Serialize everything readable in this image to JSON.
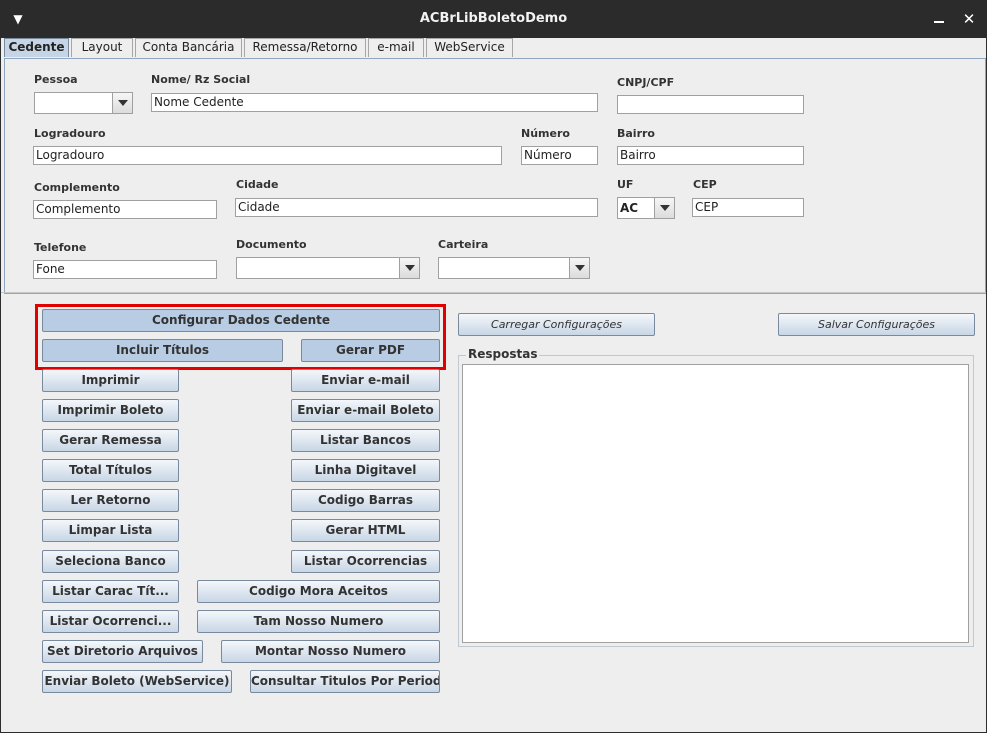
{
  "window": {
    "title": "ACBrLibBoletoDemo"
  },
  "tabs": [
    {
      "label": "Cedente"
    },
    {
      "label": "Layout"
    },
    {
      "label": "Conta Bancária"
    },
    {
      "label": "Remessa/Retorno"
    },
    {
      "label": "e-mail"
    },
    {
      "label": "WebService"
    }
  ],
  "form": {
    "pessoa": {
      "label": "Pessoa",
      "value": ""
    },
    "nome": {
      "label": "Nome/ Rz Social",
      "value": "Nome Cedente"
    },
    "cnpj": {
      "label": "CNPJ/CPF",
      "value": ""
    },
    "logradouro": {
      "label": "Logradouro",
      "value": "Logradouro"
    },
    "numero": {
      "label": "Número",
      "value": "Número"
    },
    "bairro": {
      "label": "Bairro",
      "value": "Bairro"
    },
    "complemento": {
      "label": "Complemento",
      "value": "Complemento"
    },
    "cidade": {
      "label": "Cidade",
      "value": "Cidade"
    },
    "uf": {
      "label": "UF",
      "value": "AC"
    },
    "cep": {
      "label": "CEP",
      "value": "CEP"
    },
    "telefone": {
      "label": "Telefone",
      "value": "Fone"
    },
    "documento": {
      "label": "Documento",
      "value": ""
    },
    "carteira": {
      "label": "Carteira",
      "value": ""
    }
  },
  "buttons": {
    "configurar": "Configurar Dados Cedente",
    "incluir": "Incluir Títulos",
    "gerar_pdf": "Gerar PDF",
    "imprimir": "Imprimir",
    "enviar_email": "Enviar e-mail",
    "imprimir_boleto": "Imprimir Boleto",
    "enviar_email_boleto": "Enviar e-mail Boleto",
    "gerar_remessa": "Gerar Remessa",
    "listar_bancos": "Listar Bancos",
    "total_titulos": "Total Títulos",
    "linha_digitavel": "Linha Digitavel",
    "ler_retorno": "Ler Retorno",
    "codigo_barras": "Codigo Barras",
    "limpar_lista": "Limpar Lista",
    "gerar_html": "Gerar HTML",
    "seleciona_banco": "Seleciona Banco",
    "listar_ocorrencias": "Listar Ocorrencias",
    "listar_carac": "Listar Carac Tít...",
    "codigo_mora": "Codigo Mora Aceitos",
    "listar_ocorrenci": "Listar Ocorrenci...",
    "tam_nosso": "Tam Nosso Numero",
    "set_diretorio": "Set Diretorio Arquivos",
    "montar_nosso": "Montar Nosso Numero",
    "enviar_boleto_ws": "Enviar Boleto (WebService)",
    "consultar_titulos": "Consultar Titulos Por Periodo",
    "carregar_config": "Carregar Configurações",
    "salvar_config": "Salvar Configurações"
  },
  "respostas": {
    "title": "Respostas",
    "content": ""
  },
  "colors": {
    "highlight": "#e00000",
    "tab_active": "#c5d5e6",
    "button_gradient_end": "#c8d6e6"
  }
}
